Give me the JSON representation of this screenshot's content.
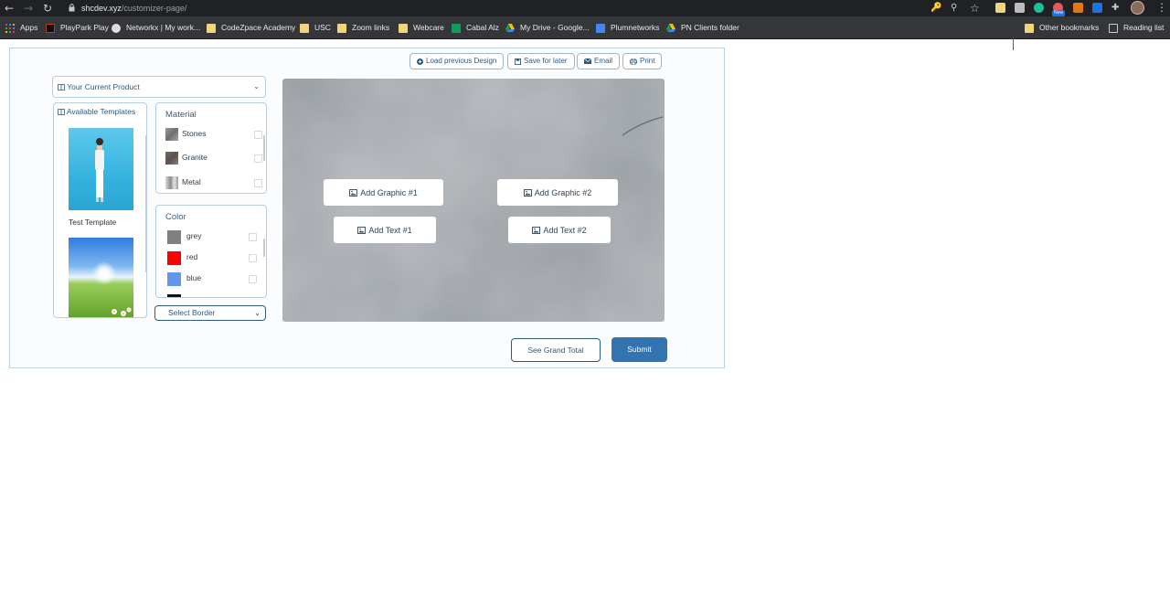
{
  "browser": {
    "url_host": "shcdev.xyz",
    "url_path": "/customizer-page/",
    "new_badge": "New",
    "bookmarks": [
      {
        "label": "Apps",
        "icon": "apps-grid-icon"
      },
      {
        "label": "PlayPark Play",
        "icon": "playpark-icon"
      },
      {
        "label": "Networkx | My work...",
        "icon": "wordpress-icon"
      },
      {
        "label": "CodeZpace Academy",
        "icon": "folder-icon"
      },
      {
        "label": "USC",
        "icon": "folder-icon"
      },
      {
        "label": "Zoom links",
        "icon": "folder-icon"
      },
      {
        "label": "Webcare",
        "icon": "folder-icon"
      },
      {
        "label": "Cabal Alz",
        "icon": "sheets-icon"
      },
      {
        "label": "My Drive - Google...",
        "icon": "drive-icon"
      },
      {
        "label": "Plumnetworks",
        "icon": "docs-icon"
      },
      {
        "label": "PN Clients folder",
        "icon": "drive-icon"
      }
    ],
    "other_bookmarks": "Other bookmarks",
    "reading_list": "Reading list"
  },
  "toolbar": {
    "load_label": "Load previous Design",
    "save_label": "Save for later",
    "email_label": "Email",
    "print_label": "Print"
  },
  "product_select": {
    "value": "Your Current Product"
  },
  "templates": {
    "header": "Available Templates",
    "items": [
      {
        "name": "Test Template"
      }
    ]
  },
  "material": {
    "title": "Material",
    "options": [
      {
        "label": "Stones"
      },
      {
        "label": "Granite"
      },
      {
        "label": "Metal"
      }
    ]
  },
  "color": {
    "title": "Color",
    "options": [
      {
        "label": "grey",
        "swatch": "#808080"
      },
      {
        "label": "red",
        "swatch": "#ff0000"
      },
      {
        "label": "blue",
        "swatch": "#6495ed"
      }
    ]
  },
  "border_select": {
    "value": "Select Border"
  },
  "canvas": {
    "buttons": [
      {
        "label": "Add Graphic #1"
      },
      {
        "label": "Add Graphic #2"
      },
      {
        "label": "Add Text #1"
      },
      {
        "label": "Add Text #2"
      }
    ]
  },
  "actions": {
    "grand_total_label": "See Grand Total",
    "submit_label": "Submit"
  }
}
